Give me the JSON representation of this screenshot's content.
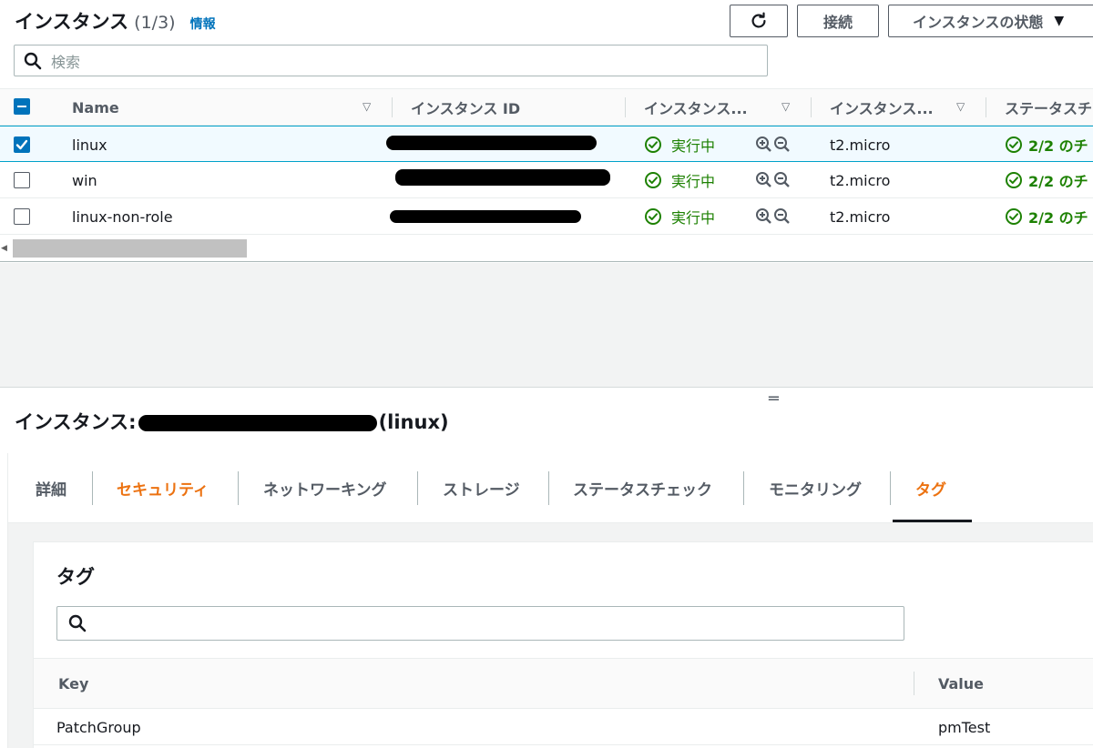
{
  "header": {
    "title": "インスタンス",
    "count": "(1/3)",
    "info_link": "情報",
    "connect_label": "接続",
    "state_label": "インスタンスの状態"
  },
  "search": {
    "placeholder": "検索"
  },
  "table": {
    "columns": [
      "Name",
      "インスタンス ID",
      "インスタンス...",
      "インスタンス...",
      "ステータスチ"
    ],
    "rows": [
      {
        "name": "linux",
        "state": "実行中",
        "type": "t2.micro",
        "status_check": "2/2 のチ",
        "selected": true
      },
      {
        "name": "win",
        "state": "実行中",
        "type": "t2.micro",
        "status_check": "2/2 のチ",
        "selected": false
      },
      {
        "name": "linux-non-role",
        "state": "実行中",
        "type": "t2.micro",
        "status_check": "2/2 のチ",
        "selected": false
      }
    ]
  },
  "details": {
    "title_prefix": "インスタンス:",
    "title_suffix": "(linux)",
    "tabs": [
      "詳細",
      "セキュリティ",
      "ネットワーキング",
      "ストレージ",
      "ステータスチェック",
      "モニタリング",
      "タグ"
    ],
    "active_tab": "タグ"
  },
  "tags": {
    "title": "タグ",
    "search_placeholder": "",
    "columns": {
      "key": "Key",
      "value": "Value"
    },
    "rows": [
      {
        "key": "PatchGroup",
        "value": "pmTest"
      }
    ]
  },
  "colors": {
    "accent_blue": "#0073bb",
    "success_green": "#1d8102",
    "orange": "#ec7211",
    "text": "#16191f"
  }
}
